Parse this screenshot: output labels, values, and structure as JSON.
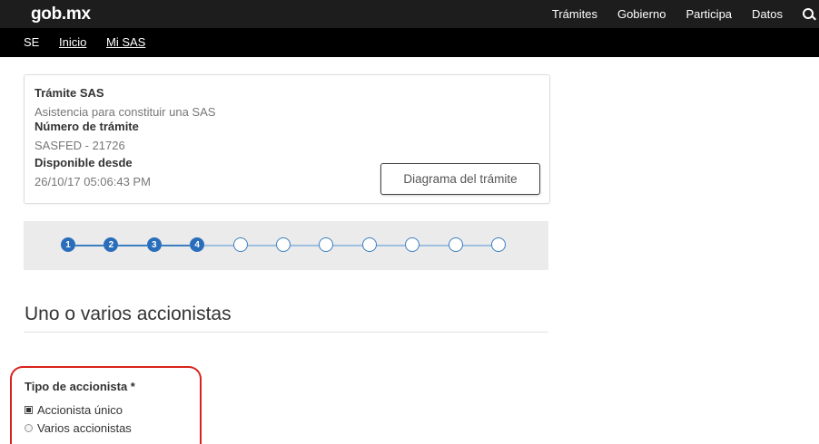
{
  "header": {
    "logo": "gob.mx",
    "nav": [
      "Trámites",
      "Gobierno",
      "Participa",
      "Datos"
    ]
  },
  "subnav": {
    "section": "SE",
    "links": [
      "Inicio",
      "Mi SAS"
    ]
  },
  "card": {
    "tramite_label": "Trámite SAS",
    "tramite_value": "Asistencia para constituir una SAS",
    "numero_label": "Número de trámite",
    "numero_value": "SASFED - 21726",
    "disponible_label": "Disponible desde",
    "disponible_value": "26/10/17 05:06:43 PM",
    "diagram_button": "Diagrama del trámite"
  },
  "stepper": {
    "total_steps": 11,
    "completed_labels": [
      "1",
      "2",
      "3",
      "4"
    ]
  },
  "section": {
    "title": "Uno o varios accionistas"
  },
  "form": {
    "field_label": "Tipo de accionista *",
    "options": [
      {
        "label": "Accionista único",
        "selected": true
      },
      {
        "label": "Varios accionistas",
        "selected": false
      }
    ]
  },
  "colors": {
    "topbar": "#1d1d1d",
    "subbar": "#000000",
    "step_active": "#2a6ebb",
    "highlight": "#d9221c"
  }
}
